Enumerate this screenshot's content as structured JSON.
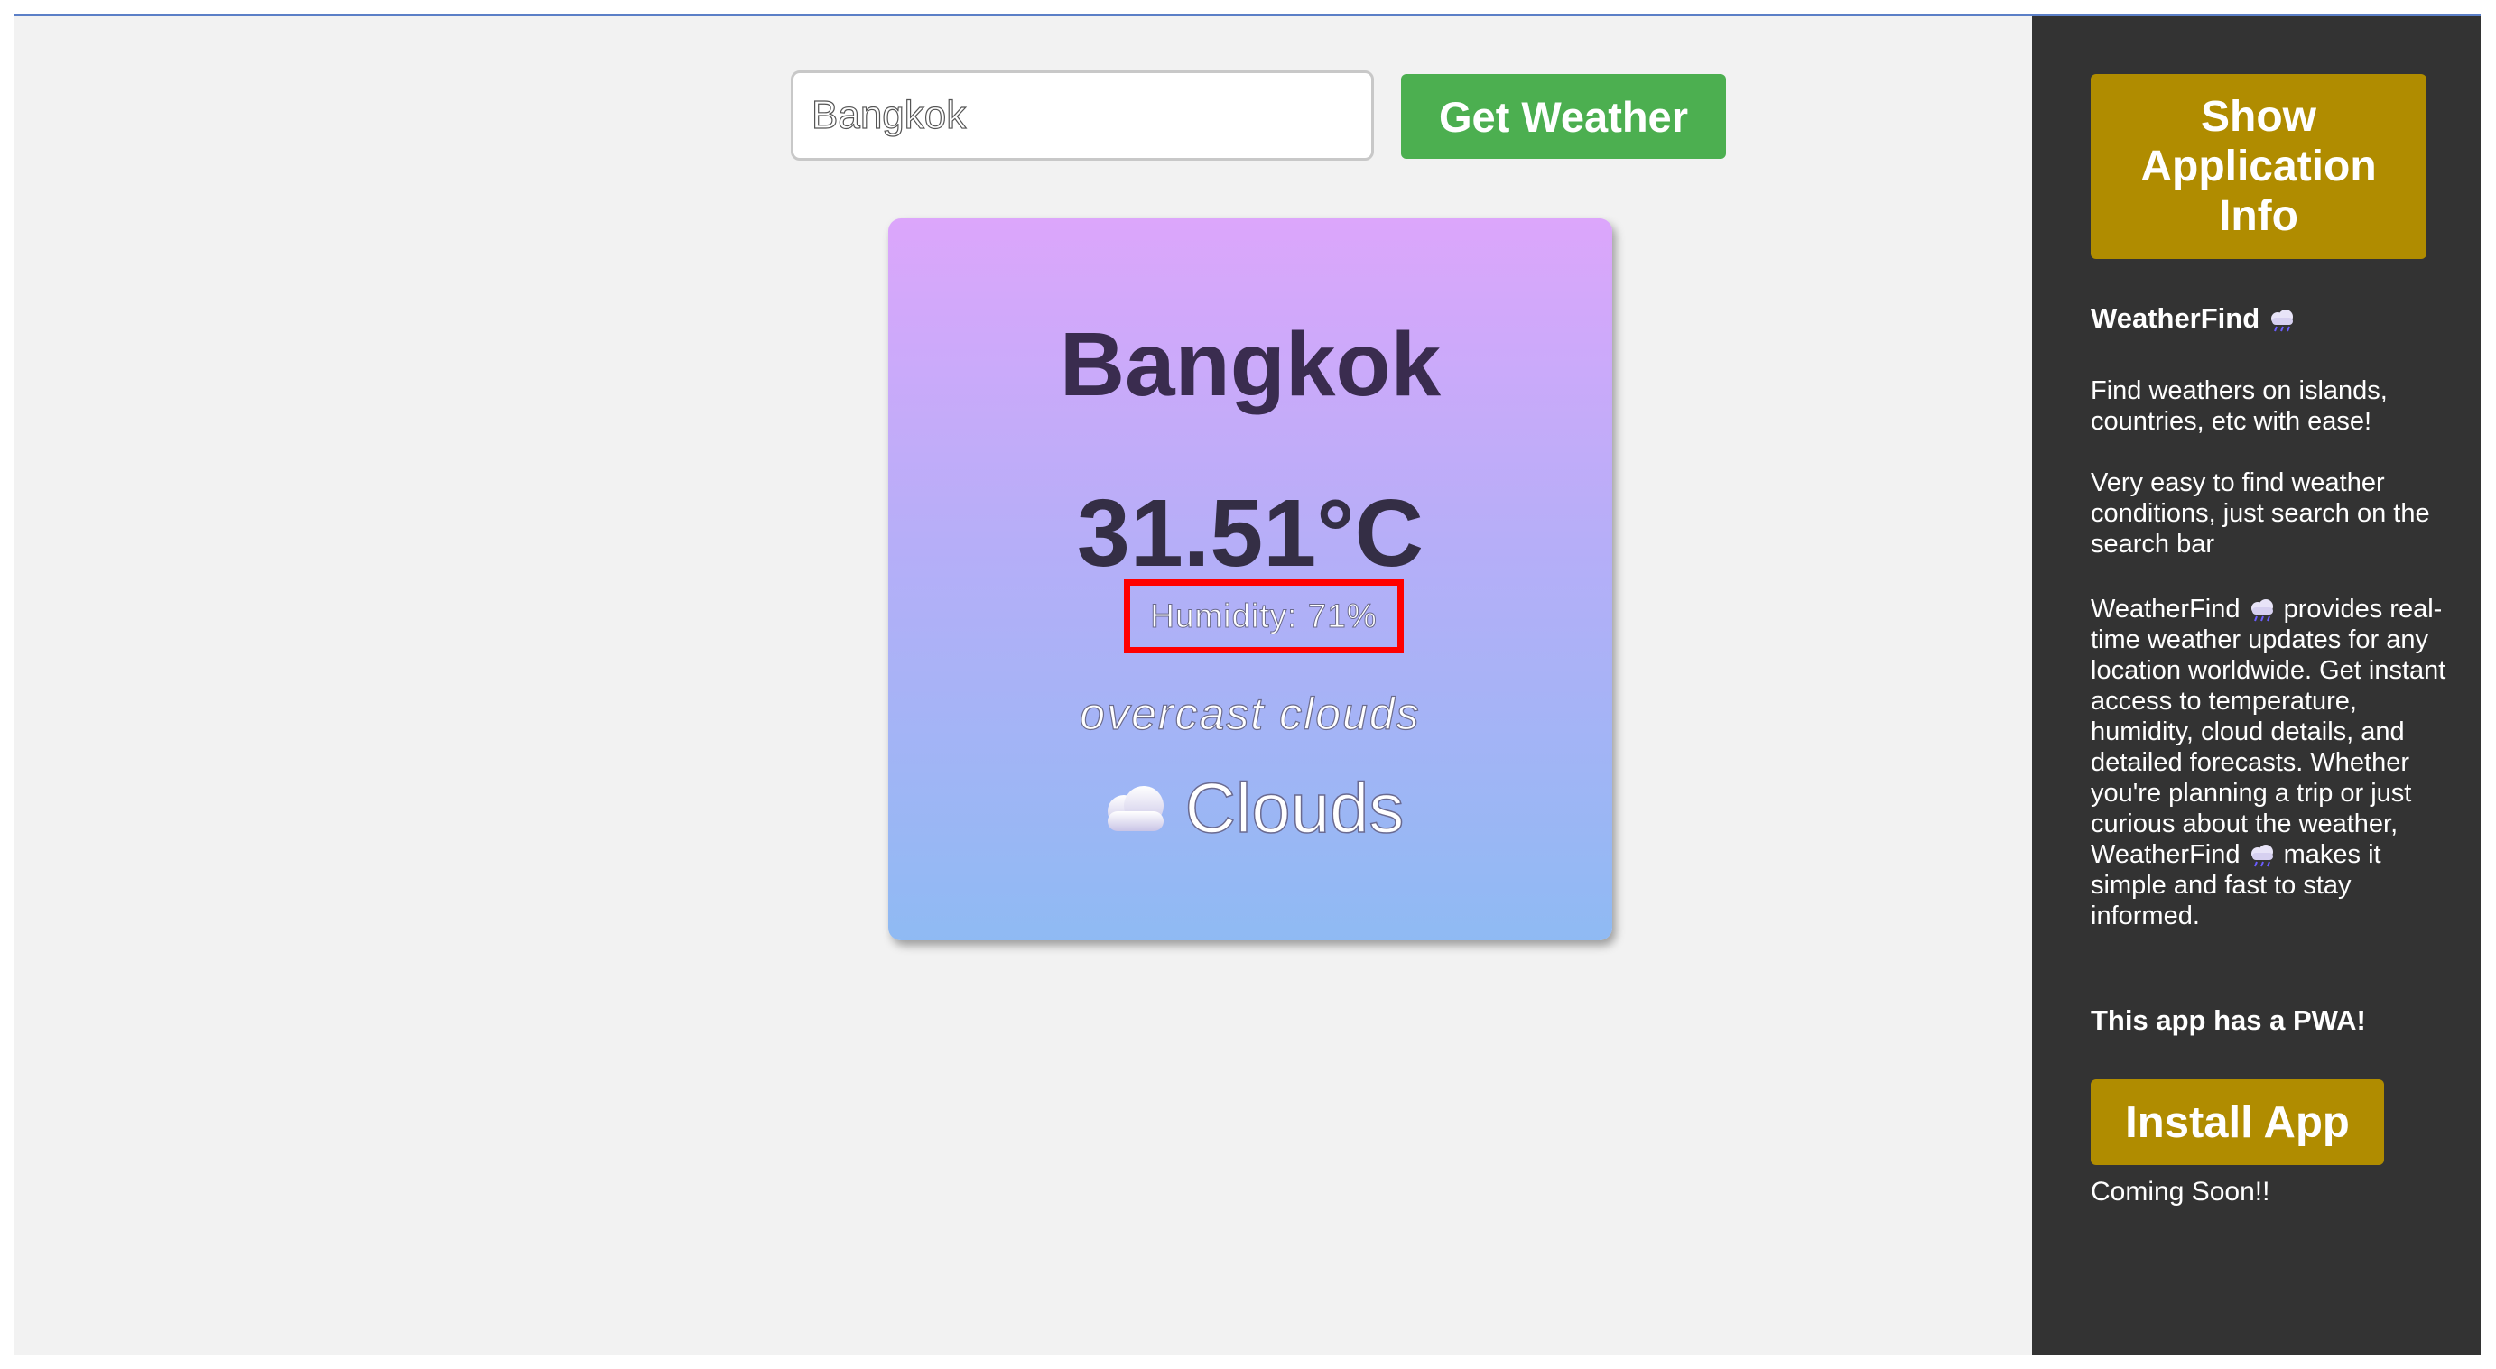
{
  "search": {
    "value": "Bangkok",
    "button_label": "Get Weather"
  },
  "card": {
    "city": "Bangkok",
    "temperature": "31.51°C",
    "humidity": "Humidity: 71%",
    "description": "overcast clouds",
    "condition": "Clouds",
    "condition_icon": "cloud-icon"
  },
  "sidebar": {
    "info_button_label": "Show Application Info",
    "app_name": "WeatherFind",
    "app_icon": "cloud-with-rain-icon",
    "tagline": "Find weathers on islands, countries, etc with ease!",
    "easy_text": "Very easy to find weather conditions, just search on the search bar",
    "desc_part1": "WeatherFind",
    "desc_part2": "provides real-time weather updates for any location worldwide. Get instant access to temperature, humidity, cloud details, and detailed forecasts. Whether you're planning a trip or just curious about the weather,",
    "desc_part3": "WeatherFind",
    "desc_part4": "makes it simple and fast to stay informed.",
    "pwa_text": "This app has a PWA!",
    "install_label": "Install App",
    "coming_soon": "Coming Soon!!"
  },
  "colors": {
    "accent_green": "#4caf50",
    "accent_gold": "#b08c00",
    "sidebar_bg": "#333333",
    "highlight_box": "#ff0000"
  }
}
